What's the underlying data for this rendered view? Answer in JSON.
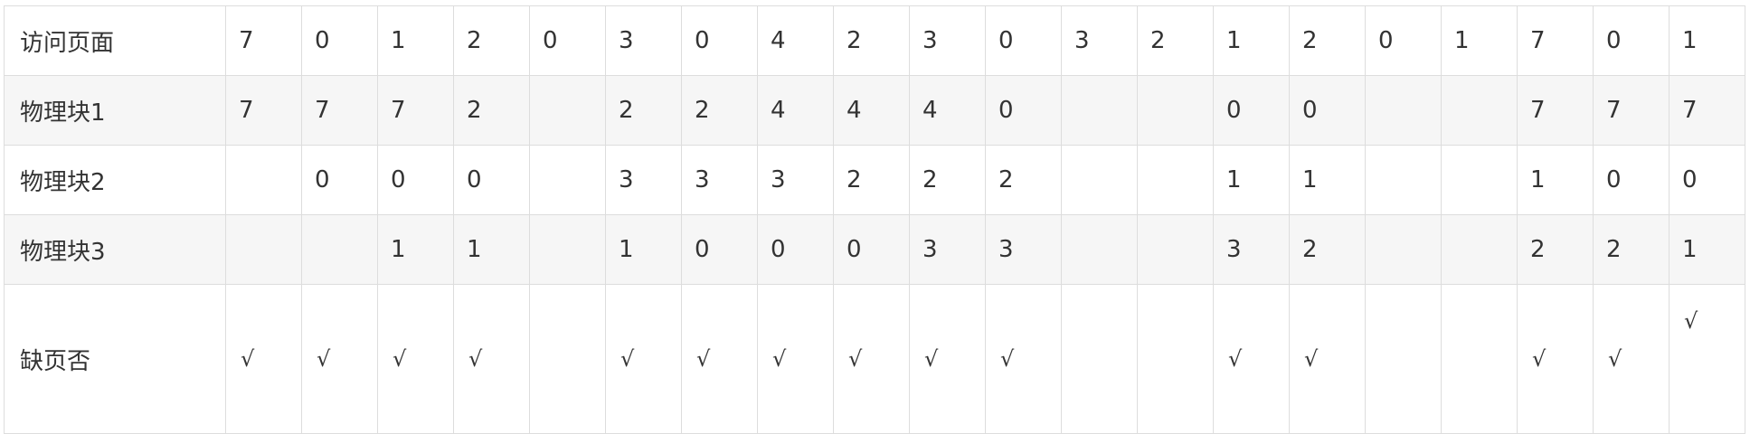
{
  "table": {
    "rows": [
      {
        "label": "访问页面",
        "cells": [
          "7",
          "0",
          "1",
          "2",
          "0",
          "3",
          "0",
          "4",
          "2",
          "3",
          "0",
          "3",
          "2",
          "1",
          "2",
          "0",
          "1",
          "7",
          "0",
          "1"
        ]
      },
      {
        "label": "物理块1",
        "cells": [
          "7",
          "7",
          "7",
          "2",
          "",
          "2",
          "2",
          "4",
          "4",
          "4",
          "0",
          "",
          "",
          "0",
          "0",
          "",
          "",
          "7",
          "7",
          "7"
        ]
      },
      {
        "label": "物理块2",
        "cells": [
          "",
          "0",
          "0",
          "0",
          "",
          "3",
          "3",
          "3",
          "2",
          "2",
          "2",
          "",
          "",
          "1",
          "1",
          "",
          "",
          "1",
          "0",
          "0"
        ]
      },
      {
        "label": "物理块3",
        "cells": [
          "",
          "",
          "1",
          "1",
          "",
          "1",
          "0",
          "0",
          "0",
          "3",
          "3",
          "",
          "",
          "3",
          "2",
          "",
          "",
          "2",
          "2",
          "1"
        ]
      },
      {
        "label": "缺页否",
        "cells": [
          "√",
          "√",
          "√",
          "√",
          "",
          "√",
          "√",
          "√",
          "√",
          "√",
          "√",
          "",
          "",
          "√",
          "√",
          "",
          "",
          "√",
          "√",
          "√"
        ]
      }
    ]
  }
}
